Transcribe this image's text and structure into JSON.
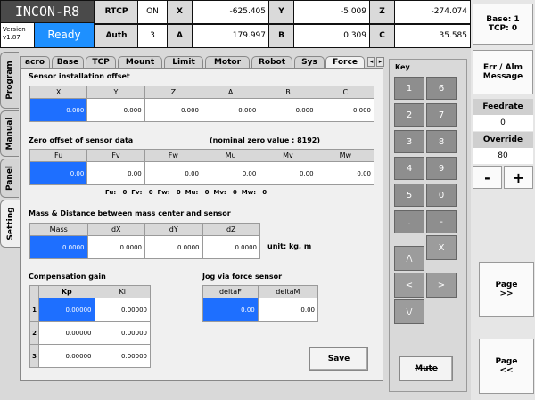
{
  "header": {
    "logo": "INCON-R8",
    "version_label": "Version",
    "version": "v1.87",
    "status": "Ready",
    "rtcp_label": "RTCP",
    "rtcp_value": "ON",
    "auth_label": "Auth",
    "auth_value": "3",
    "coords": [
      {
        "label": "X",
        "value": "-625.405"
      },
      {
        "label": "Y",
        "value": "-5.009"
      },
      {
        "label": "Z",
        "value": "-274.074"
      },
      {
        "label": "A",
        "value": "179.997"
      },
      {
        "label": "B",
        "value": "0.309"
      },
      {
        "label": "C",
        "value": "35.585"
      }
    ]
  },
  "right_panel": {
    "base_tcp": "Base: 1\nTCP: 0",
    "err_alm": "Err / Alm\nMessage",
    "feedrate_label": "Feedrate",
    "feedrate_value": "0",
    "override_label": "Override",
    "override_value": "80",
    "minus": "-",
    "plus": "+",
    "page_next": "Page\n>>",
    "page_prev": "Page\n<<"
  },
  "side_tabs": [
    "Program",
    "Manual",
    "Panel",
    "Setting"
  ],
  "top_tabs": [
    "acro",
    "Base",
    "TCP",
    "Mount",
    "Limit",
    "Motor",
    "Robot",
    "Sys",
    "Force"
  ],
  "sensor_offset": {
    "title": "Sensor installation offset",
    "headers": [
      "X",
      "Y",
      "Z",
      "A",
      "B",
      "C"
    ],
    "values": [
      "0.000",
      "0.000",
      "0.000",
      "0.000",
      "0.000",
      "0.000"
    ]
  },
  "zero_offset": {
    "title": "Zero offset of sensor data",
    "nominal": "(nominal zero value : 8192)",
    "headers": [
      "Fu",
      "Fv",
      "Fw",
      "Mu",
      "Mv",
      "Mw"
    ],
    "values": [
      "0.00",
      "0.00",
      "0.00",
      "0.00",
      "0.00",
      "0.00"
    ],
    "readout": "Fu:   0  Fv:   0  Fw:   0  Mu:   0  Mv:   0  Mw:   0"
  },
  "mass": {
    "title": "Mass & Distance between mass center and sensor",
    "headers": [
      "Mass",
      "dX",
      "dY",
      "dZ"
    ],
    "values": [
      "0.0000",
      "0.0000",
      "0.0000",
      "0.0000"
    ],
    "unit": "unit: kg, m"
  },
  "comp_gain": {
    "title": "Compensation gain",
    "headers": [
      "Kp",
      "Ki"
    ],
    "rows": [
      {
        "n": "1",
        "kp": "0.00000",
        "ki": "0.00000"
      },
      {
        "n": "2",
        "kp": "0.00000",
        "ki": "0.00000"
      },
      {
        "n": "3",
        "kp": "0.00000",
        "ki": "0.00000"
      }
    ]
  },
  "jog": {
    "title": "Jog via force sensor",
    "headers": [
      "deltaF",
      "deltaM"
    ],
    "values": [
      "0.00",
      "0.00"
    ]
  },
  "save_label": "Save",
  "keypad": {
    "title": "Key",
    "keys": [
      "1",
      "6",
      "2",
      "7",
      "3",
      "8",
      "4",
      "9",
      "5",
      "0",
      ".",
      "-"
    ],
    "x": "X",
    "up": "/\\",
    "left": "<",
    "right": ">",
    "down": "\\/",
    "mute": "Mute"
  }
}
